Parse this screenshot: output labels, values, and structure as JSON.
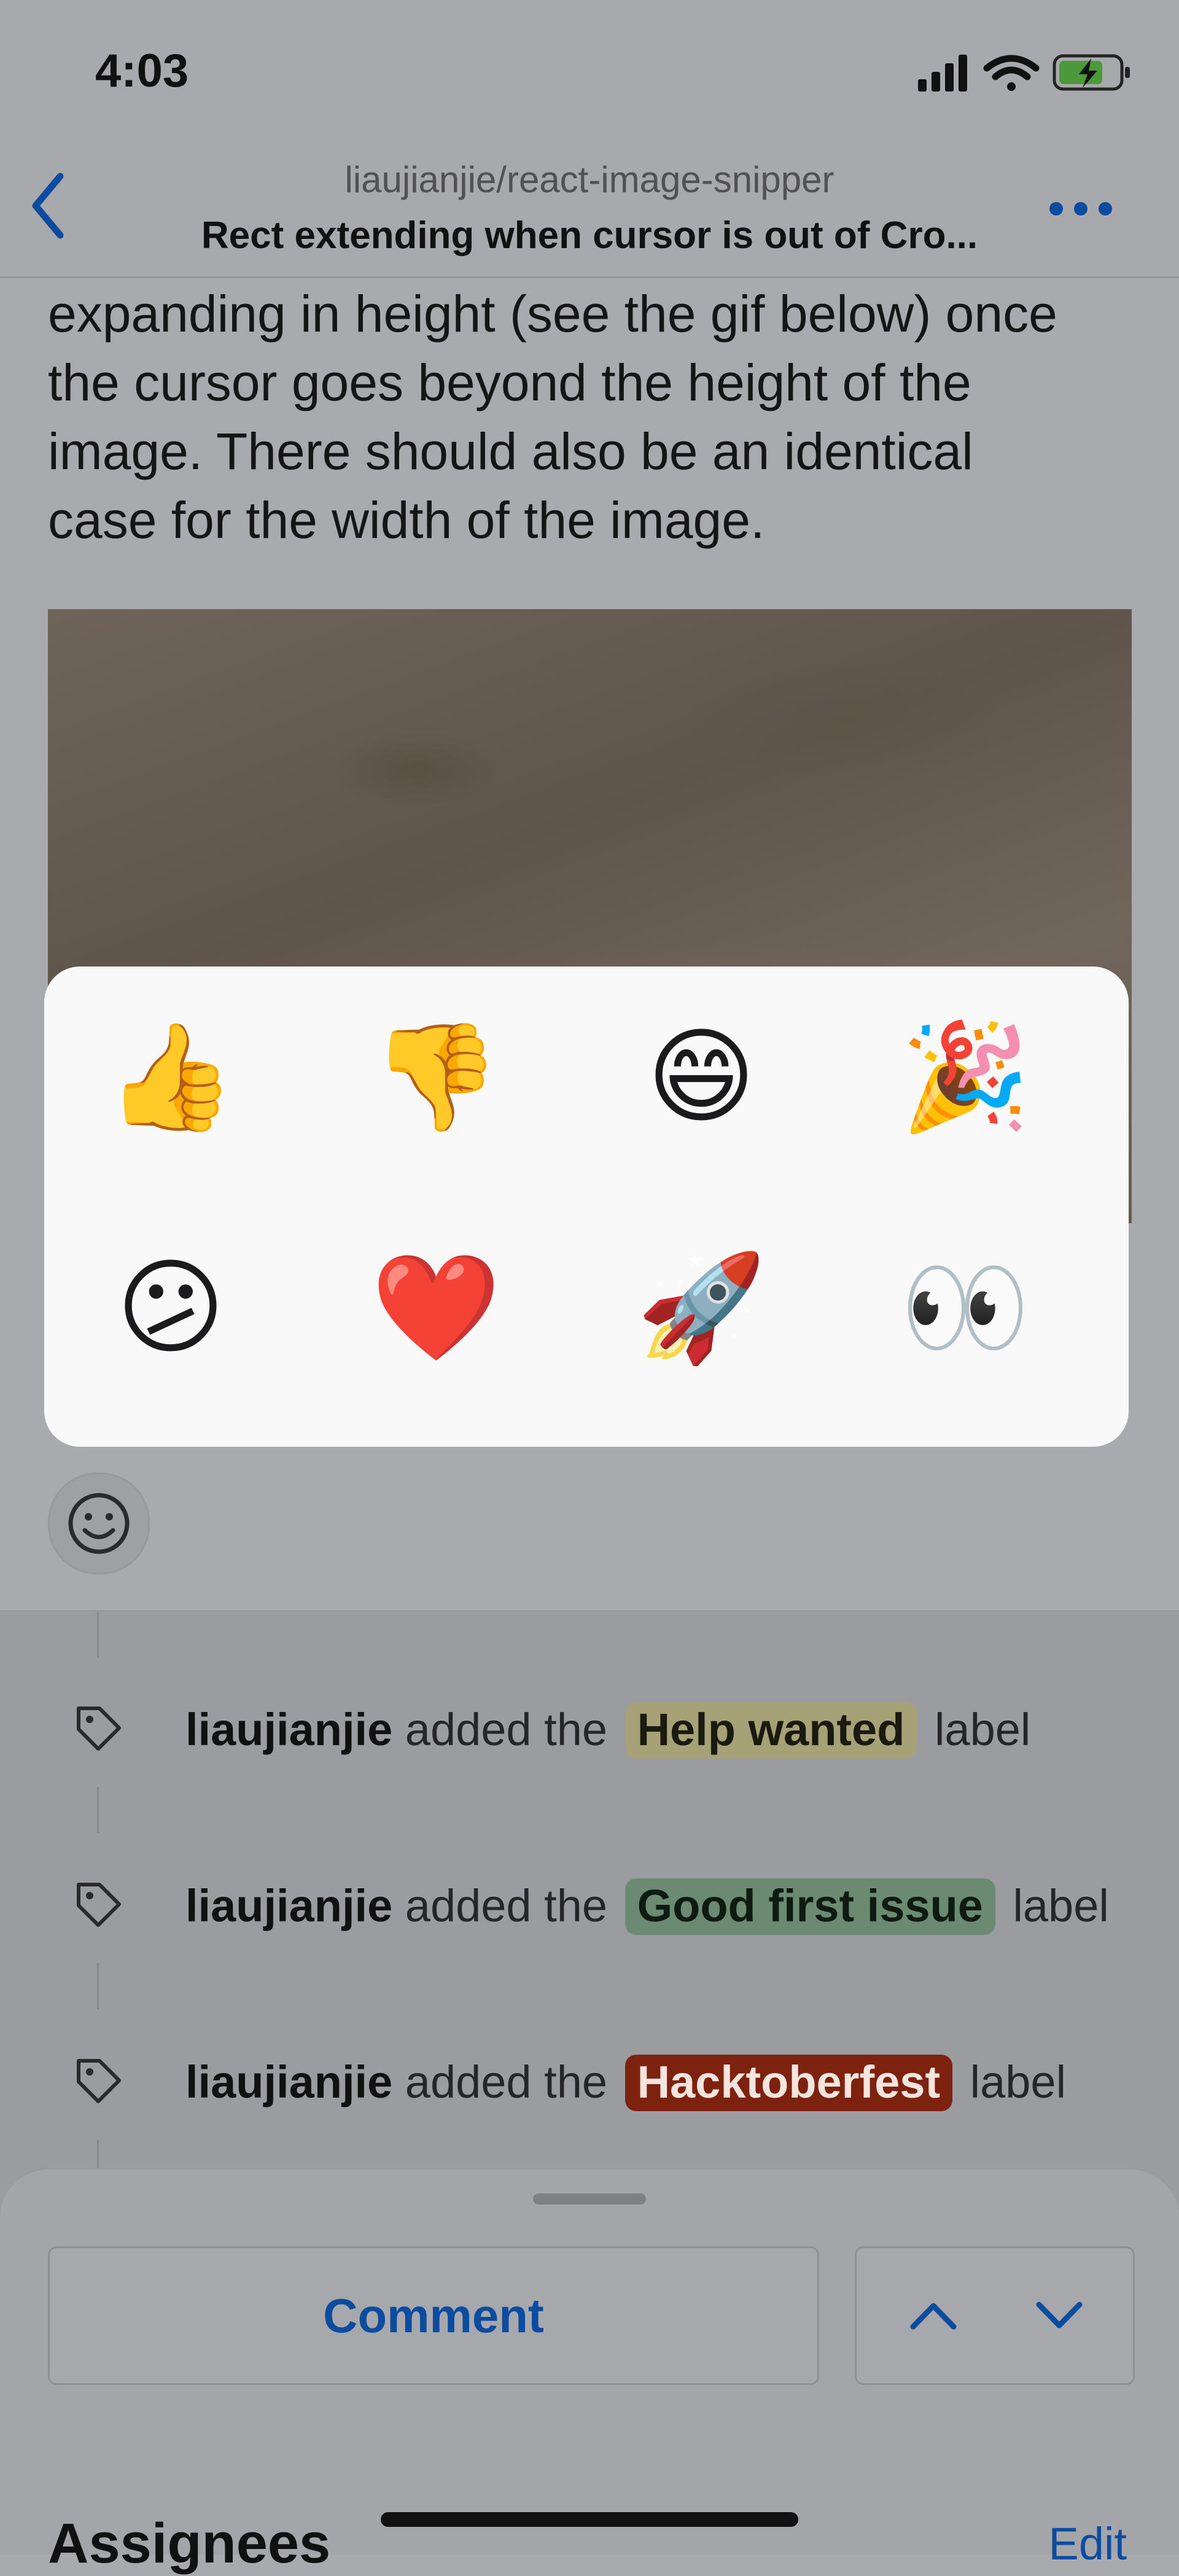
{
  "status_bar": {
    "time": "4:03"
  },
  "nav": {
    "repo": "liaujianjie/react-image-snipper",
    "title": "Rect extending when cursor is out of Cro..."
  },
  "issue_body": {
    "lines": [
      "expanding in height (see the gif below) once",
      "the cursor goes beyond the height of the",
      "image. There should also be an identical",
      "case for the width of the image."
    ]
  },
  "reaction_picker": {
    "reactions": [
      {
        "name": "thumbs-up",
        "glyph": "👍"
      },
      {
        "name": "thumbs-down",
        "glyph": "👎"
      },
      {
        "name": "laugh",
        "glyph": "😄"
      },
      {
        "name": "hooray",
        "glyph": "🎉"
      },
      {
        "name": "confused",
        "glyph": "😕"
      },
      {
        "name": "heart",
        "glyph": "❤️"
      },
      {
        "name": "rocket",
        "glyph": "🚀"
      },
      {
        "name": "eyes",
        "glyph": "👀"
      }
    ]
  },
  "timeline": {
    "events": [
      {
        "actor": "liaujianjie",
        "action": "added the",
        "label": "Help wanted",
        "suffix": "label",
        "label_color": "#a6a177"
      },
      {
        "actor": "liaujianjie",
        "action": "added the",
        "label": "Good first issue",
        "suffix": "label",
        "label_color": "#6b8a72"
      },
      {
        "actor": "liaujianjie",
        "action": "added the",
        "label": "Hacktoberfest",
        "suffix": "label",
        "label_color": "#7e2210"
      }
    ]
  },
  "bottom_sheet": {
    "comment_label": "Comment",
    "assignees_heading": "Assignees",
    "edit_label": "Edit"
  },
  "colors": {
    "accent": "#0b4ba0",
    "picker_background": "#f9f9fa"
  },
  "icons": [
    "back-chevron-icon",
    "more-icon",
    "smiley-icon",
    "tag-icon",
    "chevron-up-icon",
    "chevron-down-icon",
    "signal-icon",
    "wifi-icon",
    "battery-icon"
  ]
}
